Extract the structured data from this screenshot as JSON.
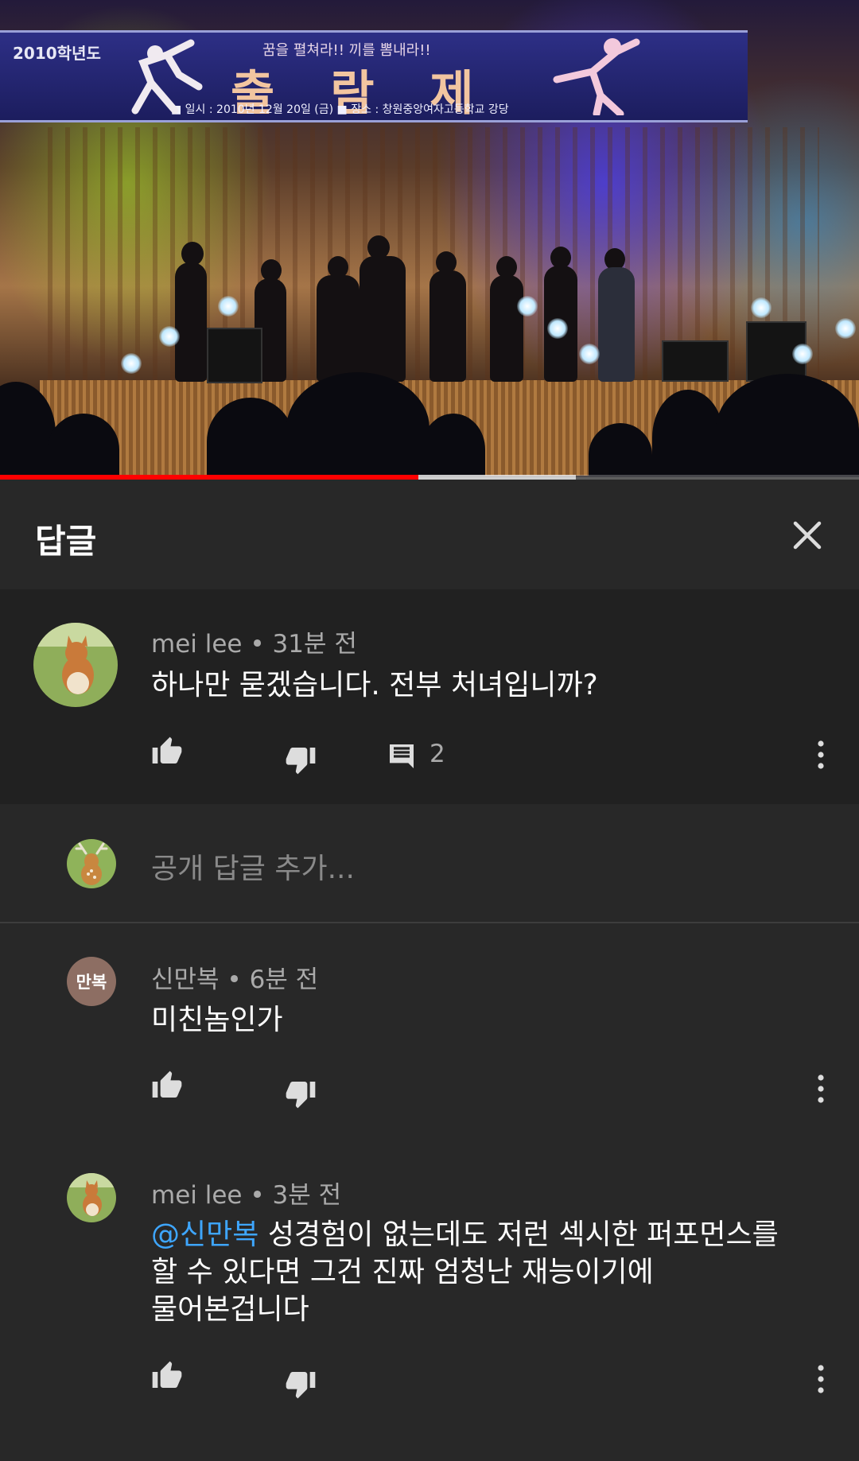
{
  "video": {
    "banner_year": "2010학년도",
    "banner_subtitle": "꿈을 펼쳐라!! 끼를 뽐내라!!",
    "banner_title": "출람제",
    "banner_info": "■ 일시 : 2010년 12월 20일 (금)    ■ 장소 : 창원중앙여자고등학교 강당",
    "progress_played_fraction": 0.487,
    "progress_buffered_fraction": 0.67
  },
  "panel": {
    "title": "답글",
    "close_icon": "close-icon"
  },
  "parent_comment": {
    "author": "mei lee",
    "time": "31분 전",
    "separator": "•",
    "text": "하나만 묻겠습니다. 전부 처녀입니까?",
    "reply_count": "2",
    "icons": [
      "thumb-up-icon",
      "thumb-down-icon",
      "reply-icon",
      "more-vert-icon"
    ]
  },
  "add_reply": {
    "placeholder": "공개 답글 추가..."
  },
  "replies": [
    {
      "author": "신만복",
      "avatar_initials": "만복",
      "avatar_color": "#8d6e63",
      "time": "6분 전",
      "text": "미친놈인가"
    },
    {
      "author": "mei lee",
      "time": "3분 전",
      "mention": "@신만복",
      "text_line1": "성경험이 없는데도 저런 섹시한 퍼포먼스를",
      "text_line2": "할 수 있다면 그건 진짜 엄청난 재능이기에",
      "text_line3": "물어본겁니다"
    }
  ],
  "colors": {
    "background": "#282828",
    "parent_background": "#212121",
    "secondary_text": "#aaaaaa",
    "mention": "#3ea6ff",
    "progress_red": "#ff0000"
  }
}
